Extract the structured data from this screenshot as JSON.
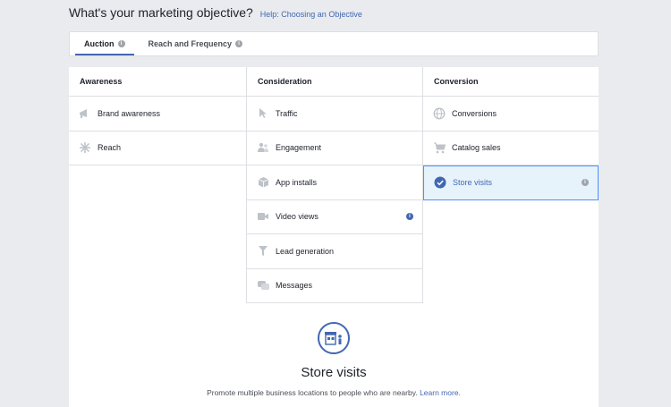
{
  "header": {
    "title": "What's your marketing objective?",
    "help_link": "Help: Choosing an Objective"
  },
  "tabs": [
    {
      "label": "Auction",
      "active": true
    },
    {
      "label": "Reach and Frequency",
      "active": false
    }
  ],
  "columns": {
    "awareness": {
      "heading": "Awareness",
      "items": [
        {
          "label": "Brand awareness",
          "icon": "megaphone-icon"
        },
        {
          "label": "Reach",
          "icon": "snowflake-icon"
        }
      ]
    },
    "consideration": {
      "heading": "Consideration",
      "items": [
        {
          "label": "Traffic",
          "icon": "cursor-icon"
        },
        {
          "label": "Engagement",
          "icon": "people-icon"
        },
        {
          "label": "App installs",
          "icon": "box-icon"
        },
        {
          "label": "Video views",
          "icon": "video-camera-icon"
        },
        {
          "label": "Lead generation",
          "icon": "filter-icon"
        },
        {
          "label": "Messages",
          "icon": "chat-bubbles-icon"
        }
      ]
    },
    "conversion": {
      "heading": "Conversion",
      "items": [
        {
          "label": "Conversions",
          "icon": "globe-icon"
        },
        {
          "label": "Catalog sales",
          "icon": "cart-icon"
        },
        {
          "label": "Store visits",
          "icon": "check-circle-icon",
          "selected": true
        }
      ]
    }
  },
  "detail": {
    "icon": "storefront-icon",
    "title": "Store visits",
    "description": "Promote multiple business locations to people who are nearby.",
    "learn_more": "Learn more."
  },
  "colors": {
    "accent": "#4267b2",
    "selected_bg": "#e7f3fb",
    "selected_border": "#4d90fe",
    "background": "#e9ebee"
  }
}
